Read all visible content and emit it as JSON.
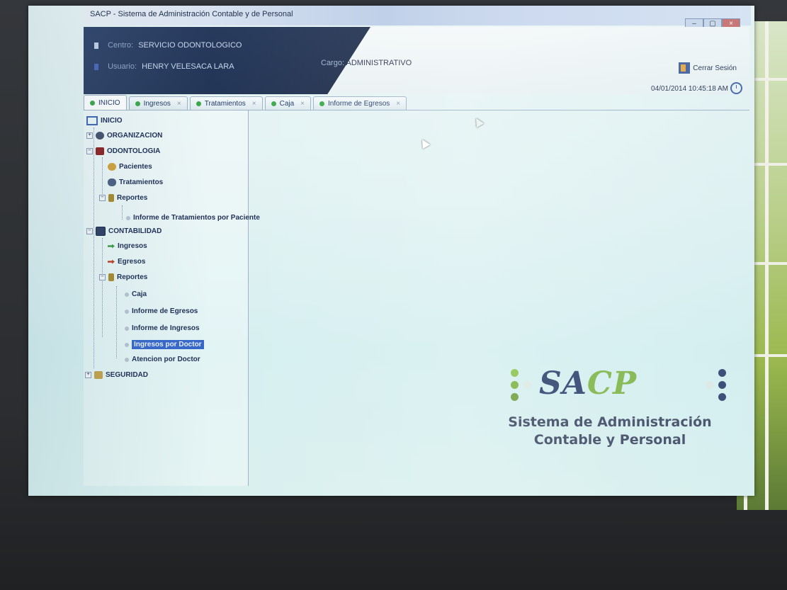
{
  "window": {
    "title": "SACP - Sistema de Administración Contable y de Personal"
  },
  "header": {
    "centro_label": "Centro:",
    "centro_value": "SERVICIO ODONTOLOGICO",
    "usuario_label": "Usuario:",
    "usuario_value": "HENRY VELESACA LARA",
    "cargo_label": "Cargo:",
    "cargo_value": "ADMINISTRATIVO",
    "logout_label": "Cerrar Sesión",
    "datetime": "04/01/2014 10:45:18 AM"
  },
  "tabs": [
    {
      "label": "INICIO",
      "closable": false
    },
    {
      "label": "Ingresos",
      "closable": true
    },
    {
      "label": "Tratamientos",
      "closable": true
    },
    {
      "label": "Caja",
      "closable": true
    },
    {
      "label": "Informe de Egresos",
      "closable": true
    }
  ],
  "tree": {
    "inicio": "INICIO",
    "organizacion": "ORGANIZACION",
    "odontologia": "ODONTOLOGIA",
    "pacientes": "Pacientes",
    "tratamientos": "Tratamientos",
    "reportes_odonto": "Reportes",
    "informe_tratamientos": "Informe de Tratamientos por Paciente",
    "contabilidad": "CONTABILIDAD",
    "ingresos": "Ingresos",
    "egresos": "Egresos",
    "reportes_conta": "Reportes",
    "caja": "Caja",
    "informe_egresos": "Informe de Egresos",
    "informe_ingresos": "Informe de Ingresos",
    "ingresos_doctor": "Ingresos por Doctor",
    "atencion_doctor": "Atencion por Doctor",
    "seguridad": "SEGURIDAD"
  },
  "logo": {
    "sa": "SA",
    "cp": "CP",
    "subtitle_line1": "Sistema de Administración",
    "subtitle_line2": "Contable y Personal",
    "colors": {
      "primary": "#2b3e6b",
      "accent": "#7cb342"
    }
  },
  "icons": {
    "tab_dot": "green-dot-icon",
    "close": "close-icon",
    "logout": "door-exit-icon",
    "clock": "clock-icon"
  }
}
